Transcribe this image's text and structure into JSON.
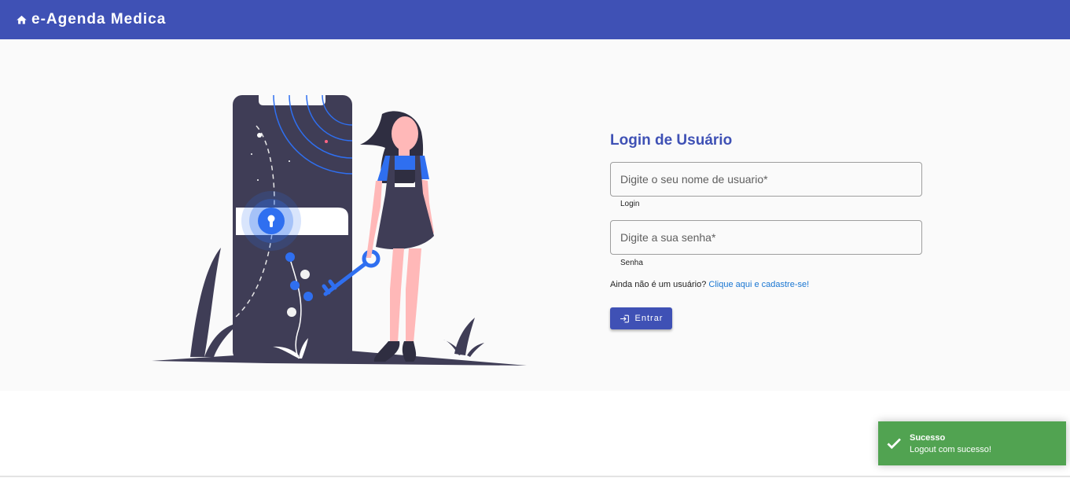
{
  "header": {
    "title": "e-Agenda Medica",
    "home_icon": "home-icon",
    "background": "#3f51b5"
  },
  "login": {
    "title": "Login de Usuário",
    "username": {
      "placeholder": "Digite o seu nome de usuario*",
      "value": "",
      "hint": "Login"
    },
    "password": {
      "placeholder": "Digite a sua senha*",
      "value": "",
      "hint": "Senha"
    },
    "register_prompt": "Ainda não é um usuário?",
    "register_link": "Clique aqui e cadastre-se!",
    "submit_label": "Entrar",
    "submit_icon": "login-icon",
    "accent": "#3f51b5",
    "link_color": "#1976d2"
  },
  "toast": {
    "title": "Sucesso",
    "message": "Logout com sucesso!",
    "icon": "check-icon",
    "background": "#51a351"
  },
  "illustration": {
    "icon": "phone-lock-woman-key-illustration",
    "colors": {
      "dark": "#3f3d56",
      "accent": "#2f6ff0",
      "skin": "#ffb8b8"
    }
  }
}
